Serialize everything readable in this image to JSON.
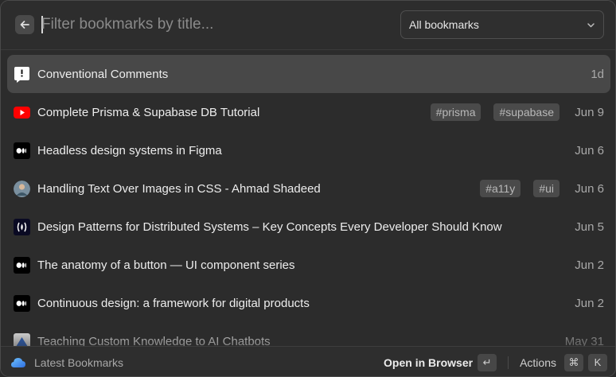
{
  "header": {
    "search_placeholder": "Filter bookmarks by title...",
    "filter_selected": "All bookmarks"
  },
  "bookmarks": [
    {
      "title": "Conventional Comments",
      "tags": [],
      "date": "1d",
      "icon": "speech-bubble-icon",
      "selected": true
    },
    {
      "title": "Complete Prisma & Supabase DB Tutorial",
      "tags": [
        "#prisma",
        "#supabase"
      ],
      "date": "Jun 9",
      "icon": "youtube-icon"
    },
    {
      "title": "Headless design systems in Figma",
      "tags": [],
      "date": "Jun 6",
      "icon": "medium-icon"
    },
    {
      "title": "Handling Text Over Images in CSS - Ahmad Shadeed",
      "tags": [
        "#a11y",
        "#ui"
      ],
      "date": "Jun 6",
      "icon": "avatar-icon"
    },
    {
      "title": "Design Patterns for Distributed Systems – Key Concepts Every Developer Should Know",
      "tags": [],
      "date": "Jun 5",
      "icon": "freecodecamp-icon"
    },
    {
      "title": "The anatomy of a button — UI component series",
      "tags": [],
      "date": "Jun 2",
      "icon": "medium-icon"
    },
    {
      "title": "Continuous design: a framework for digital products",
      "tags": [],
      "date": "Jun 2",
      "icon": "medium-icon"
    },
    {
      "title": "Teaching Custom Knowledge to AI Chatbots",
      "tags": [],
      "date": "May 31",
      "icon": "site-icon"
    }
  ],
  "footer": {
    "app_name": "Latest Bookmarks",
    "primary_action": "Open in Browser",
    "primary_key": "↵",
    "actions_label": "Actions",
    "actions_keys": [
      "⌘",
      "K"
    ]
  },
  "colors": {
    "background": "#2c2c2c",
    "selected_row": "#484848",
    "tag_bg": "#4a4a4a",
    "youtube_red": "#ff0000",
    "app_icon_blue": "#3b8ef0"
  }
}
